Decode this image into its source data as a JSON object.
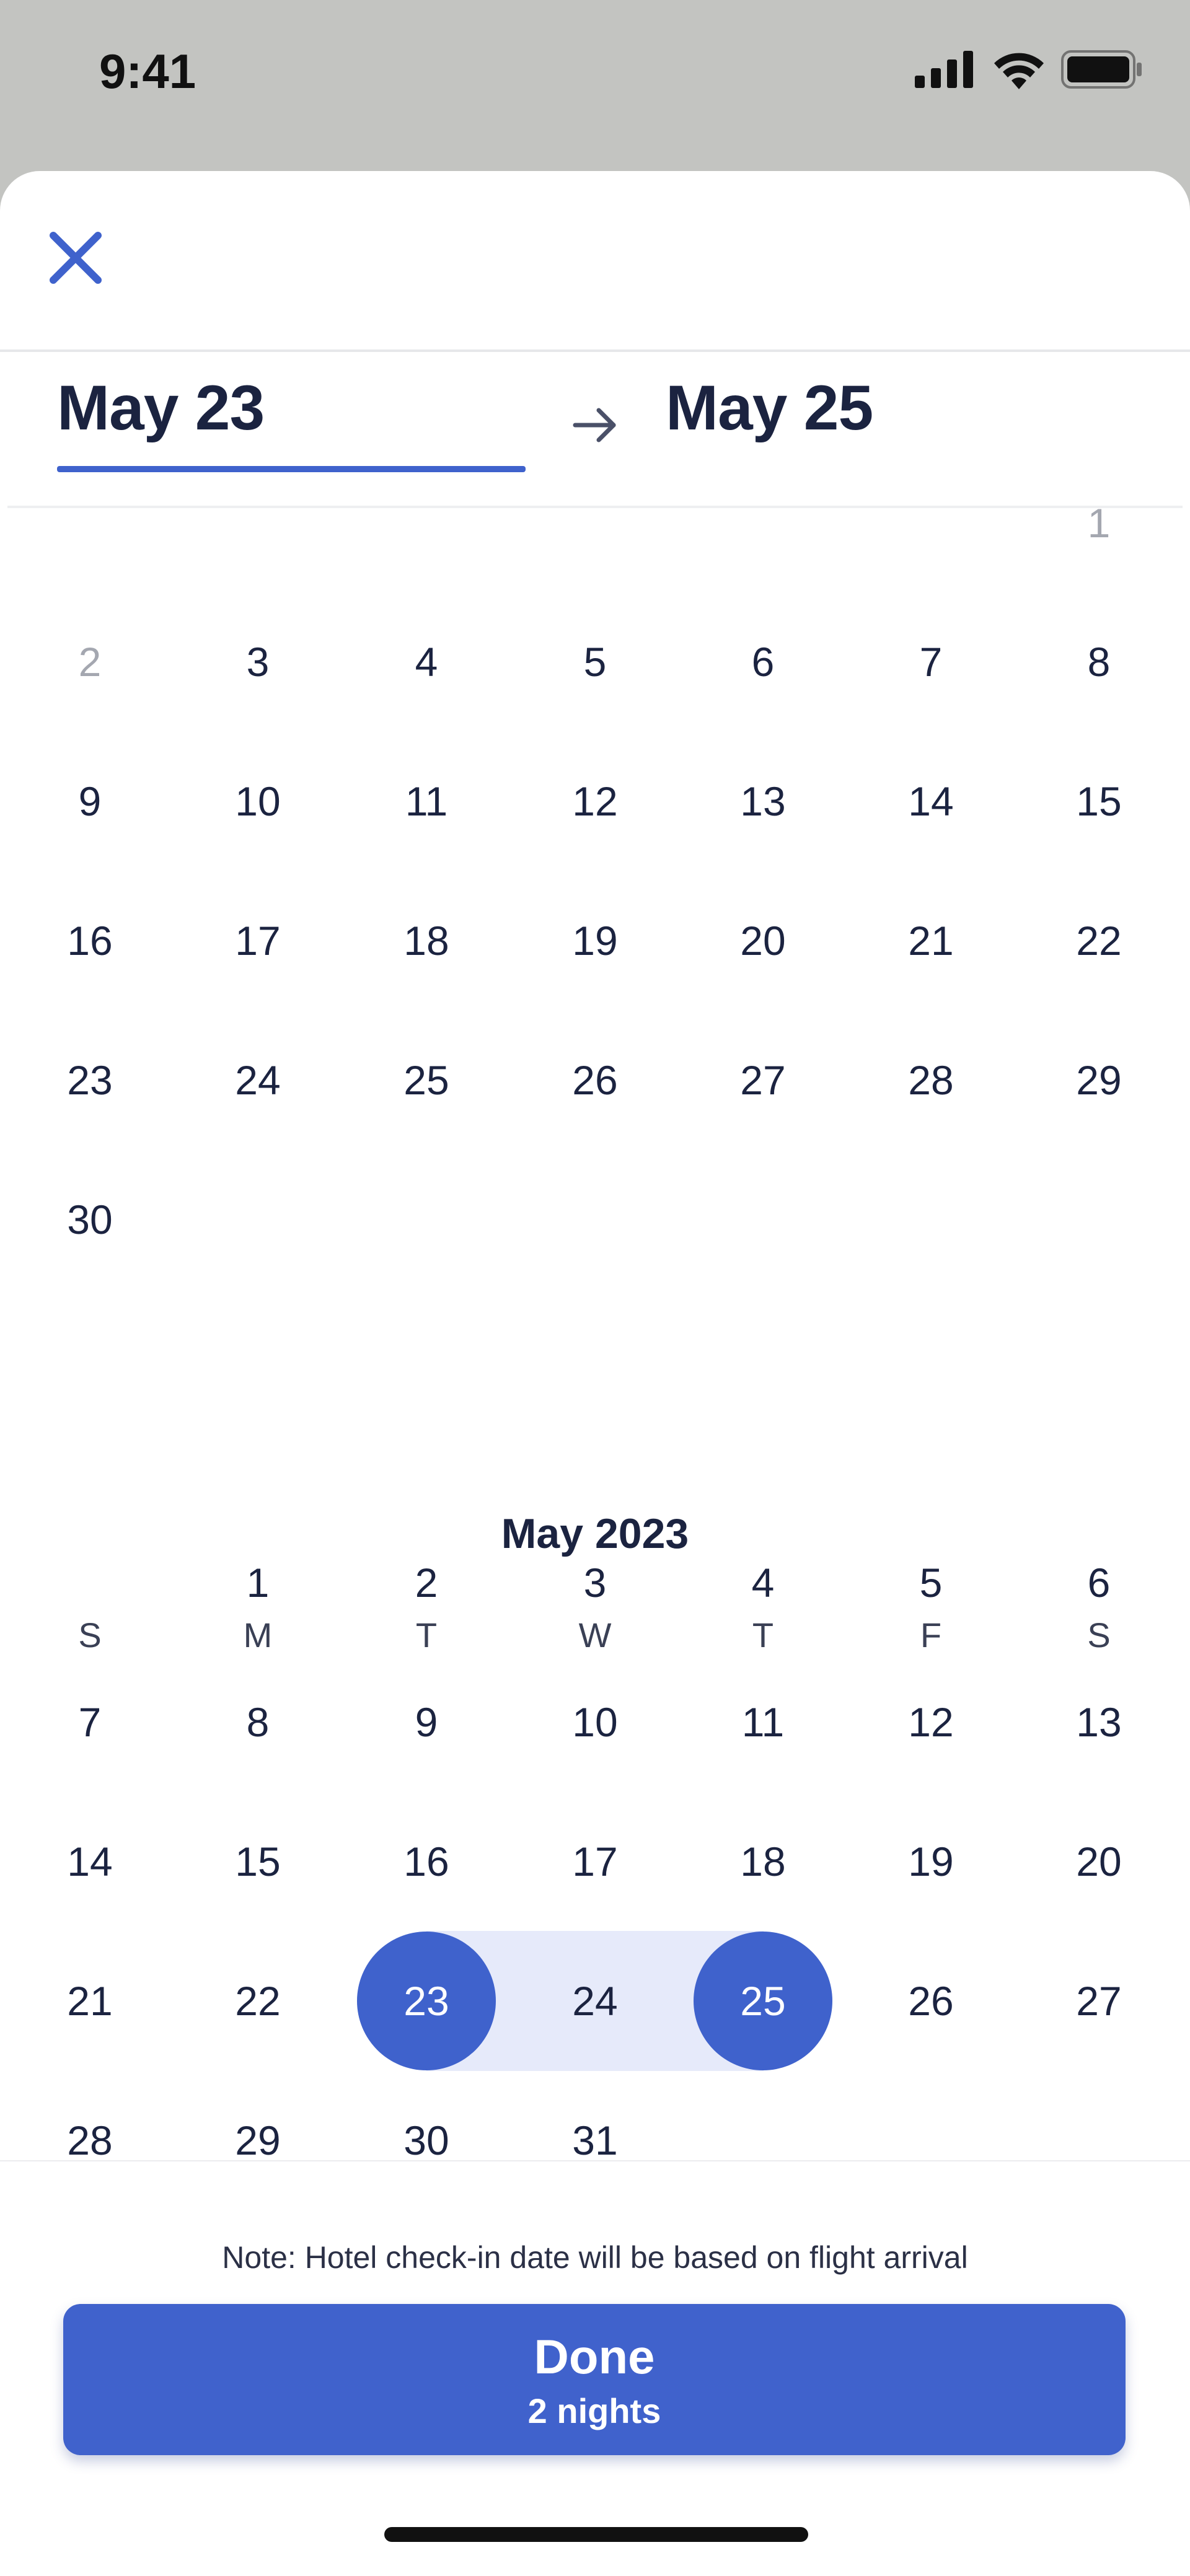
{
  "status_bar": {
    "time": "9:41",
    "icons": [
      "signal-icon",
      "wifi-icon",
      "battery-icon"
    ]
  },
  "header": {
    "close_icon": "close-icon"
  },
  "date_range": {
    "start": "May 23",
    "end": "May 25",
    "arrow_icon": "arrow-right-icon"
  },
  "prev_month": {
    "weeks": [
      [
        "",
        "",
        "",
        "",
        "",
        "",
        "1"
      ],
      [
        "2",
        "3",
        "4",
        "5",
        "6",
        "7",
        "8"
      ],
      [
        "9",
        "10",
        "11",
        "12",
        "13",
        "14",
        "15"
      ],
      [
        "16",
        "17",
        "18",
        "19",
        "20",
        "21",
        "22"
      ],
      [
        "23",
        "24",
        "25",
        "26",
        "27",
        "28",
        "29"
      ],
      [
        "30",
        "",
        "",
        "",
        "",
        "",
        ""
      ]
    ],
    "muted_days": [
      "1",
      "2"
    ]
  },
  "current_month": {
    "title": "May 2023",
    "weekdays": [
      "S",
      "M",
      "T",
      "W",
      "T",
      "F",
      "S"
    ],
    "weeks": [
      [
        "",
        "1",
        "2",
        "3",
        "4",
        "5",
        "6"
      ],
      [
        "7",
        "8",
        "9",
        "10",
        "11",
        "12",
        "13"
      ],
      [
        "14",
        "15",
        "16",
        "17",
        "18",
        "19",
        "20"
      ],
      [
        "21",
        "22",
        "23",
        "24",
        "25",
        "26",
        "27"
      ],
      [
        "28",
        "29",
        "30",
        "31",
        "",
        "",
        ""
      ]
    ],
    "selected_start": "23",
    "selected_end": "25",
    "in_range": [
      "24"
    ]
  },
  "footer": {
    "note": "Note: Hotel check-in date will be based on flight arrival",
    "done_label": "Done",
    "done_sub": "2 nights"
  },
  "colors": {
    "accent": "#4062cc",
    "range_fill": "#e6eafa",
    "text": "#1b2340",
    "muted": "#a4a7b0"
  }
}
